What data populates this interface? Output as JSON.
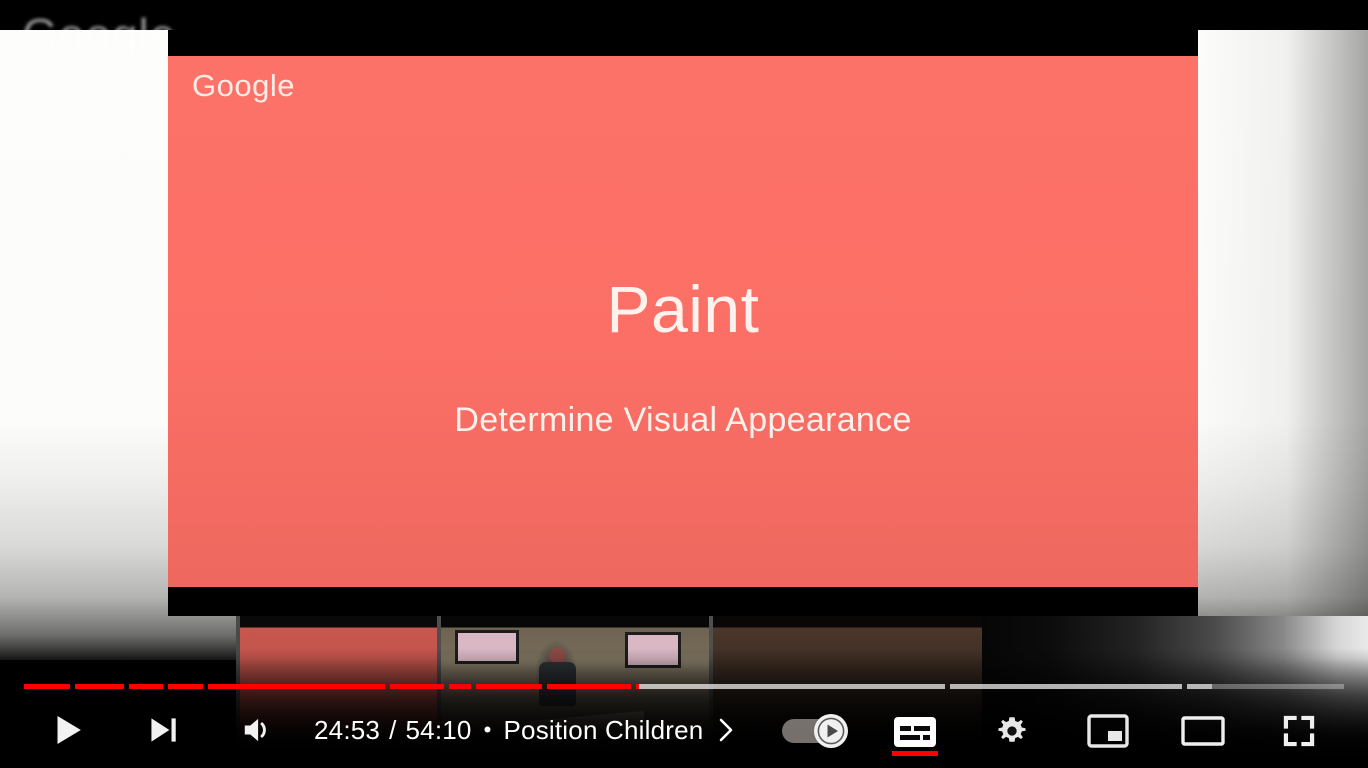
{
  "player": {
    "ambient_watermark": "Google",
    "slide": {
      "logo": "Google",
      "title": "Paint",
      "subtitle": "Determine Visual Appearance",
      "bg_color": "#fb6f66",
      "text_color": "#fdf2ec"
    }
  },
  "progress": {
    "played_color": "#ff0000",
    "buffered_color": "#ffffff8c",
    "track_color": "#ffffff52",
    "played_fraction": 0.4659,
    "buffered_fraction": 0.9,
    "chapters": [
      {
        "start": 0.0,
        "end": 0.0345
      },
      {
        "start": 0.0383,
        "end": 0.0759
      },
      {
        "start": 0.0797,
        "end": 0.105
      },
      {
        "start": 0.1088,
        "end": 0.1355
      },
      {
        "start": 0.1393,
        "end": 0.2733
      },
      {
        "start": 0.2771,
        "end": 0.3182
      },
      {
        "start": 0.322,
        "end": 0.3386
      },
      {
        "start": 0.3424,
        "end": 0.3924
      },
      {
        "start": 0.3962,
        "end": 0.4599
      },
      {
        "start": 0.4637,
        "end": 0.6976
      },
      {
        "start": 0.7014,
        "end": 0.8773
      },
      {
        "start": 0.8811,
        "end": 1.0
      }
    ]
  },
  "controls": {
    "play_label": "Play",
    "next_label": "Next",
    "volume_label": "Mute",
    "time_current": "24:53",
    "time_separator": "/",
    "time_total": "54:10",
    "chapter_dot": "•",
    "chapter_title": "Position Children",
    "chapter_chevron": "›",
    "autoplay_label": "Autoplay",
    "autoplay_state": "on",
    "subtitles_label": "Subtitles/closed captions",
    "subtitles_active": true,
    "settings_label": "Settings",
    "miniplayer_label": "Miniplayer",
    "theater_label": "Theater mode",
    "fullscreen_label": "Full screen"
  }
}
